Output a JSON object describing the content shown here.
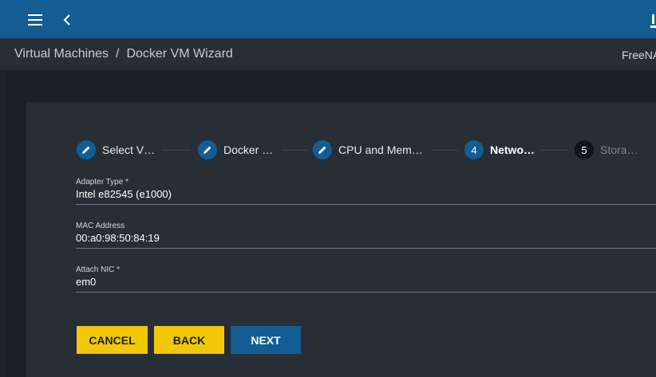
{
  "topbar": {
    "menu_icon": "hamburger-menu-icon",
    "back_icon": "chevron-left-icon",
    "color": "#135d93"
  },
  "breadcrumb": {
    "items": [
      "Virtual Machines",
      "Docker VM Wizard"
    ],
    "separator": "/"
  },
  "brand": "FreeNA",
  "wizard": {
    "steps": [
      {
        "marker": "pencil-icon",
        "label": "Select V…",
        "state": "done"
      },
      {
        "marker": "pencil-icon",
        "label": "Docker …",
        "state": "done"
      },
      {
        "marker": "pencil-icon",
        "label": "CPU and Mem…",
        "state": "done"
      },
      {
        "marker": "4",
        "label": "Netwo…",
        "state": "active"
      },
      {
        "marker": "5",
        "label": "Stora…",
        "state": "pending"
      }
    ],
    "fields": [
      {
        "label": "Adapter Type *",
        "value": "Intel e82545 (e1000)"
      },
      {
        "label": "MAC Address",
        "value": "00:a0:98:50:84:19"
      },
      {
        "label": "Attach NIC *",
        "value": "em0"
      }
    ],
    "buttons": {
      "cancel": "CANCEL",
      "back": "BACK",
      "next": "NEXT"
    }
  },
  "colors": {
    "accent": "#135d93",
    "button_yellow": "#f0c808",
    "background": "#1e242b",
    "card": "#272e36"
  }
}
